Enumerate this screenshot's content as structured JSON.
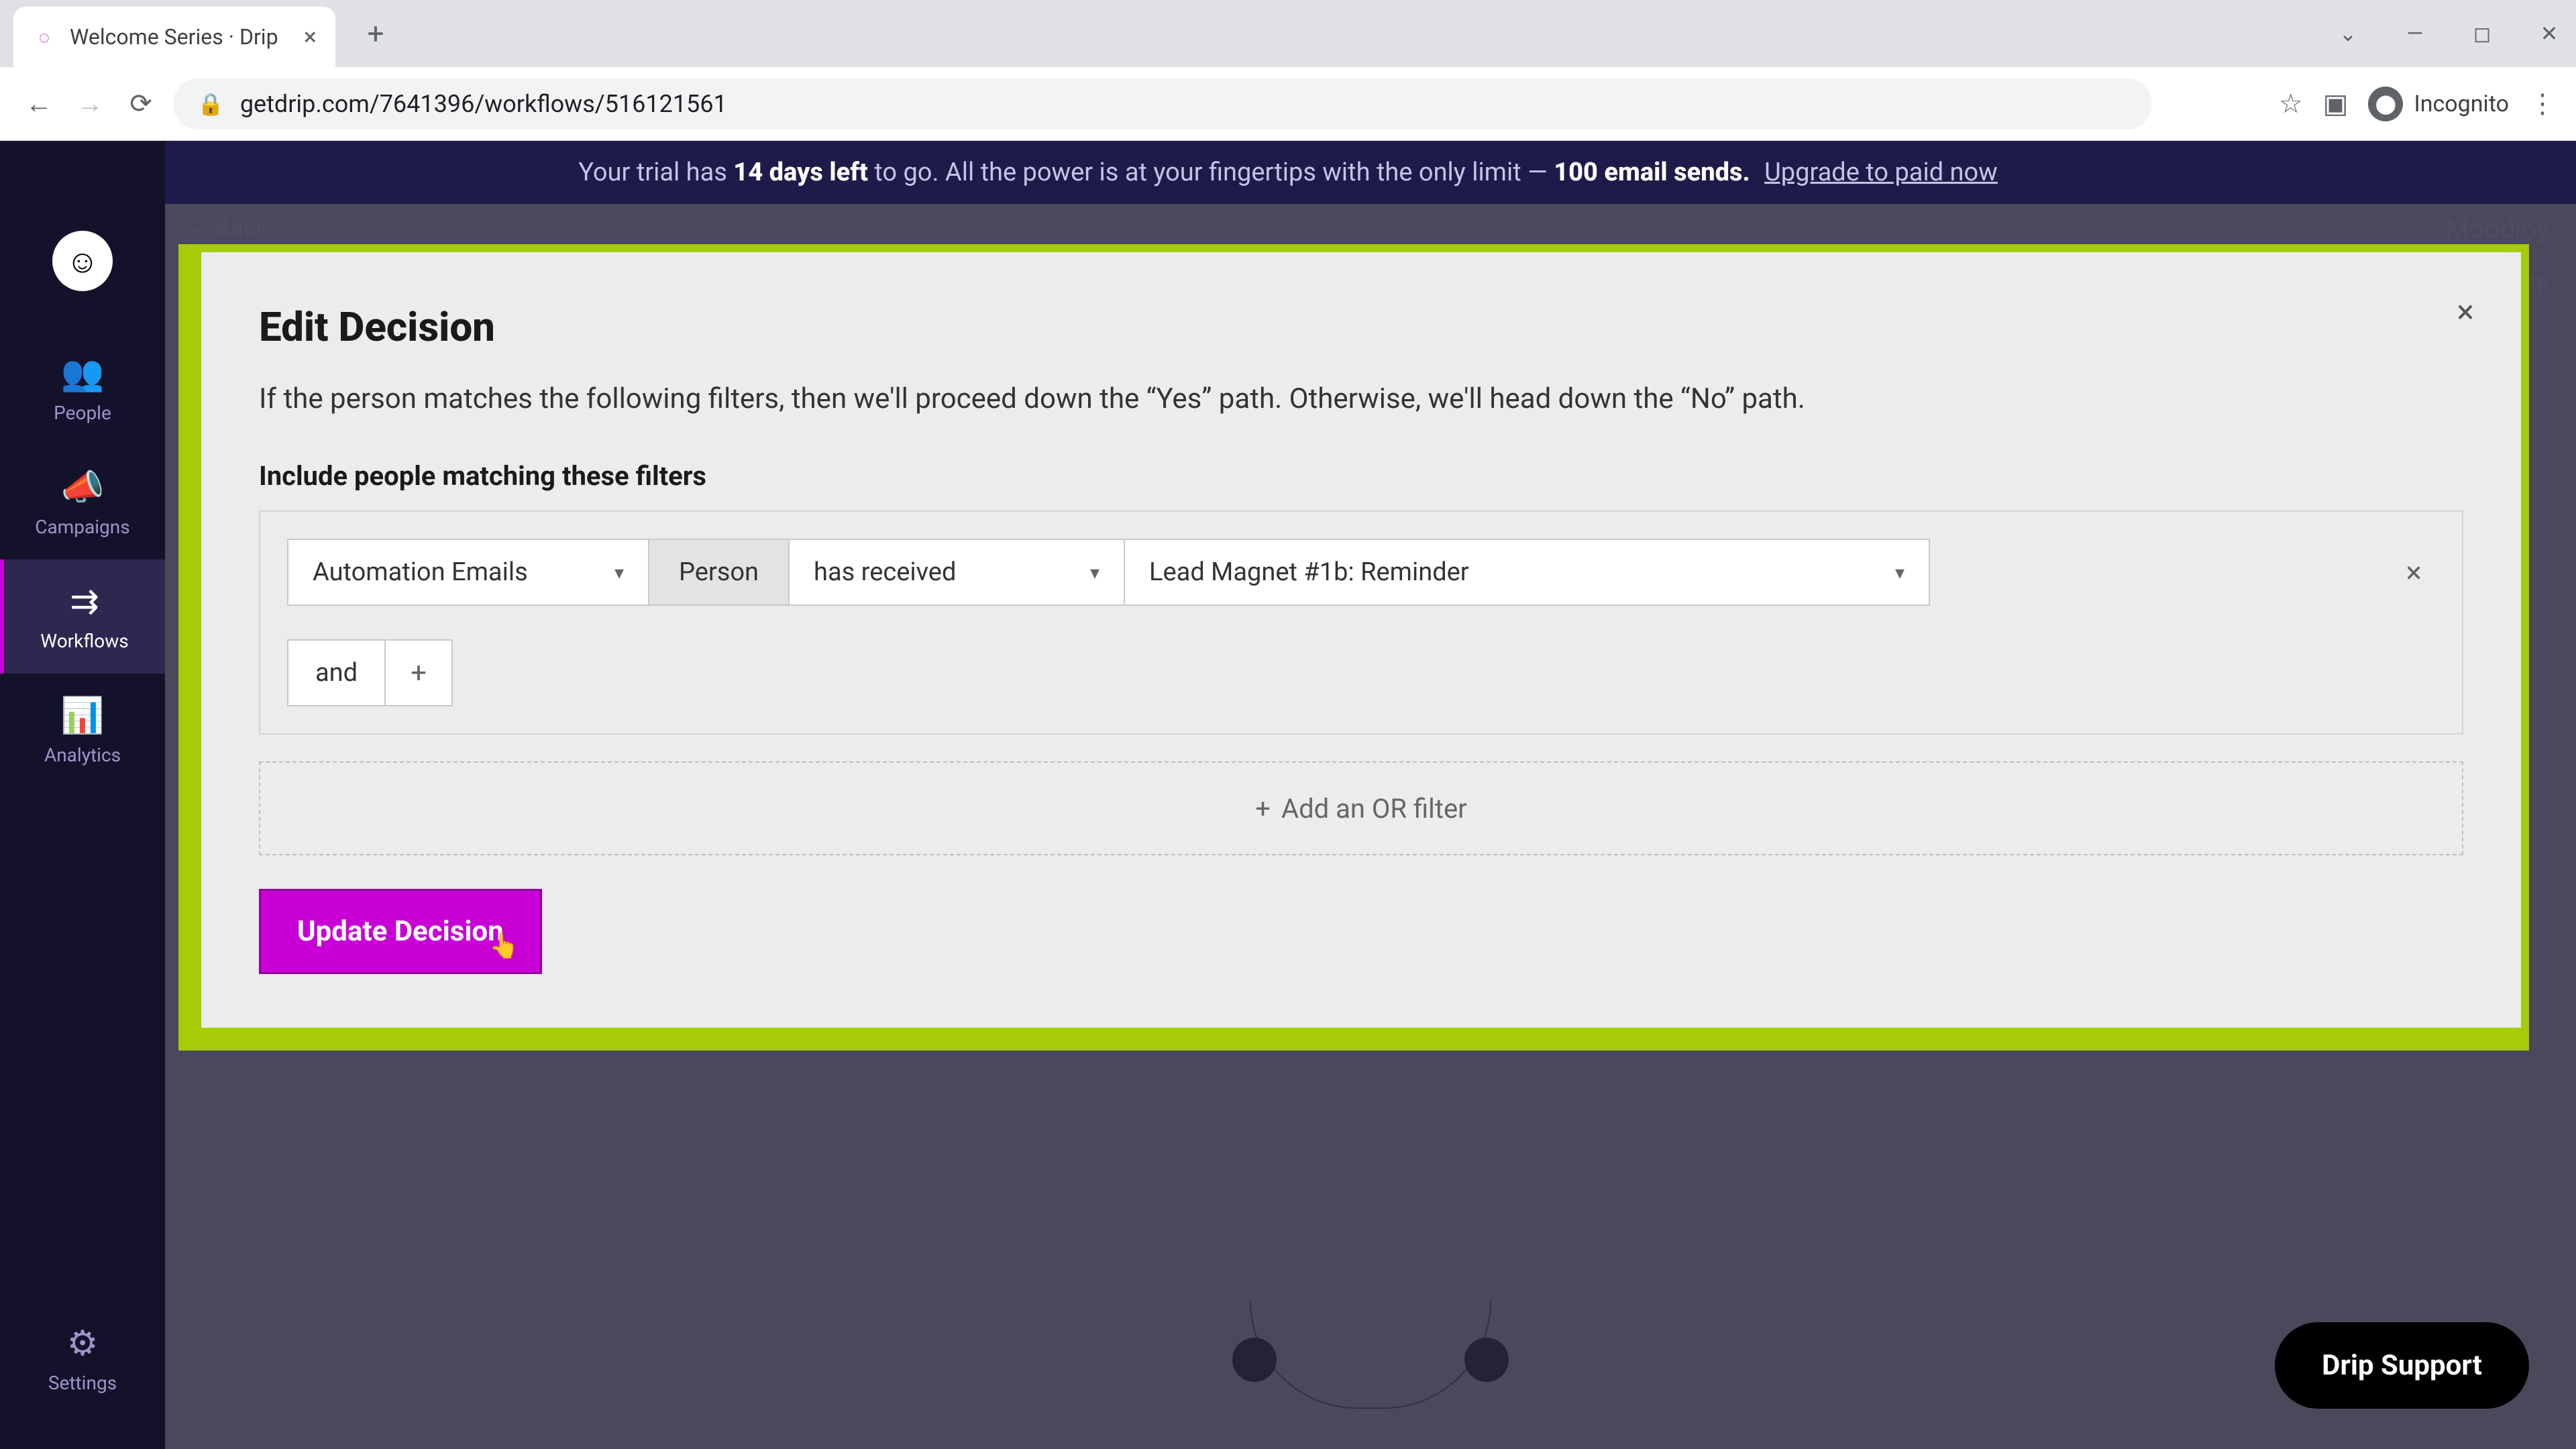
{
  "browser": {
    "tab_title": "Welcome Series · Drip",
    "url": "getdrip.com/7641396/workflows/516121561",
    "incognito_label": "Incognito"
  },
  "trial": {
    "prefix": "Your trial has ",
    "days": "14 days left",
    "middle": " to go. All the power is at your fingertips with the only limit — ",
    "sends": "100 email sends.",
    "cta": "Upgrade to paid now"
  },
  "sidebar": {
    "items": [
      {
        "label": "People"
      },
      {
        "label": "Campaigns"
      },
      {
        "label": "Workflows"
      },
      {
        "label": "Analytics"
      }
    ],
    "settings": "Settings"
  },
  "bg": {
    "back": "← Back",
    "brand": "Moodjoy",
    "toggle": "OFF"
  },
  "modal": {
    "title": "Edit Decision",
    "description": "If the person matches the following filters, then we'll proceed down the “Yes” path. Otherwise, we'll head down the “No” path.",
    "filter_heading": "Include people matching these filters",
    "select_category": "Automation Emails",
    "person_label": "Person",
    "select_condition": "has received",
    "select_email": "Lead Magnet #1b: Reminder",
    "and_label": "and",
    "or_label": "Add an OR filter",
    "update_button": "Update Decision"
  },
  "support": {
    "label": "Drip Support"
  }
}
